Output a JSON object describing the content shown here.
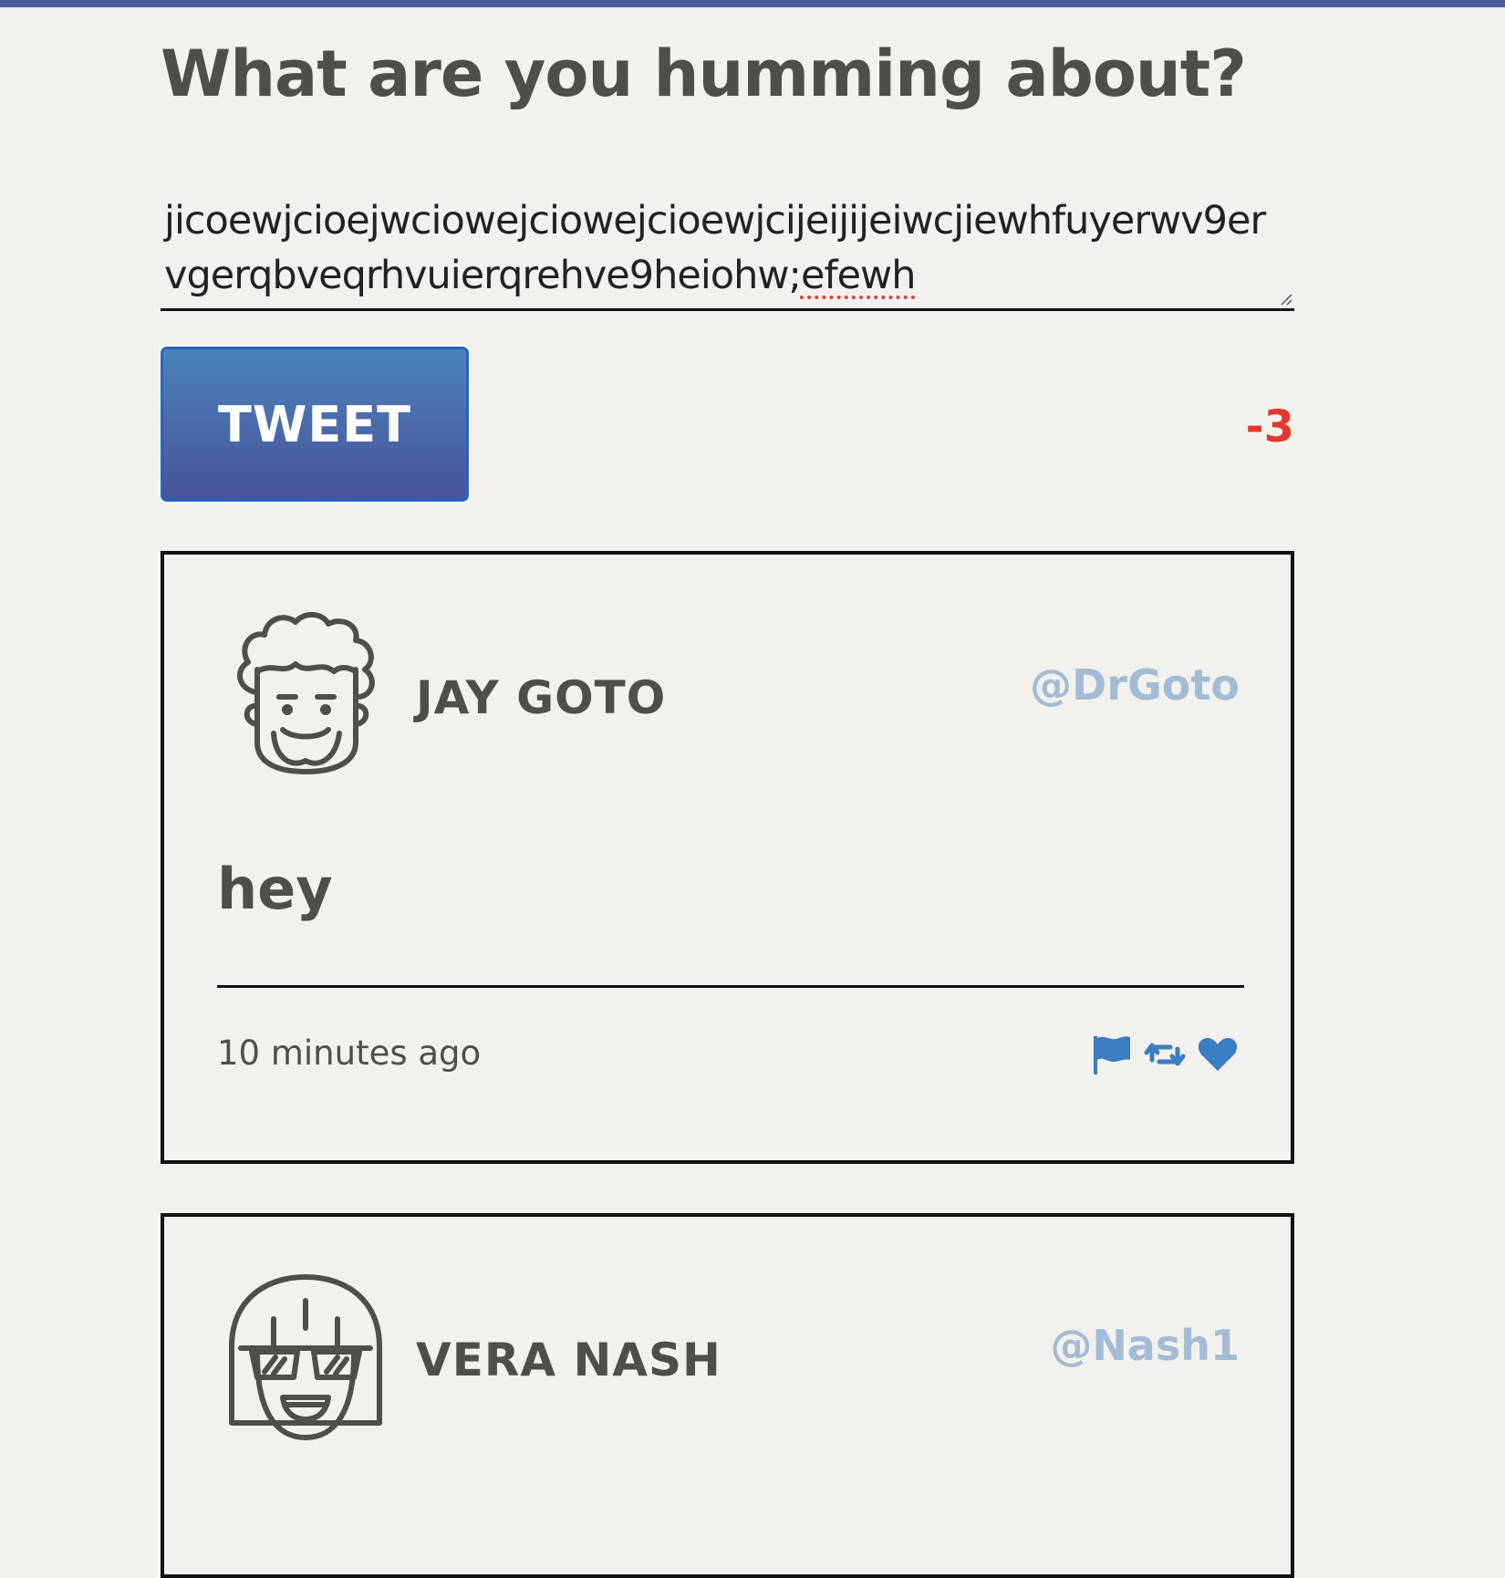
{
  "composer": {
    "title": "What are you humming about?",
    "text_line_1": "jicoewjcioejwciowejciowejcioewjcijeijijeiwcjiewhfuyerwv",
    "text_line_2_start": "9ervgerqbveqrhvuierqrehve9heiohw;",
    "text_line_2_misspelled": "efewh",
    "tweet_button_label": "Tweet",
    "char_counter": "-3",
    "char_counter_color": "#e5382c"
  },
  "colors": {
    "accent": "#4b5b9e",
    "button_top": "#4a83bb",
    "button_bottom": "#49549b",
    "handle": "#a3bcd6",
    "action_icons": "#3a7dc0"
  },
  "tweets": [
    {
      "avatar_icon": "curly-hair-face-icon",
      "name": "Jay Goto",
      "handle": "@DrGoto",
      "body": "hey",
      "timestamp": "10 minutes ago",
      "actions": [
        "flag-icon",
        "retweet-icon",
        "heart-icon"
      ]
    },
    {
      "avatar_icon": "sunglasses-face-icon",
      "name": "Vera Nash",
      "handle": "@Nash1"
    }
  ]
}
